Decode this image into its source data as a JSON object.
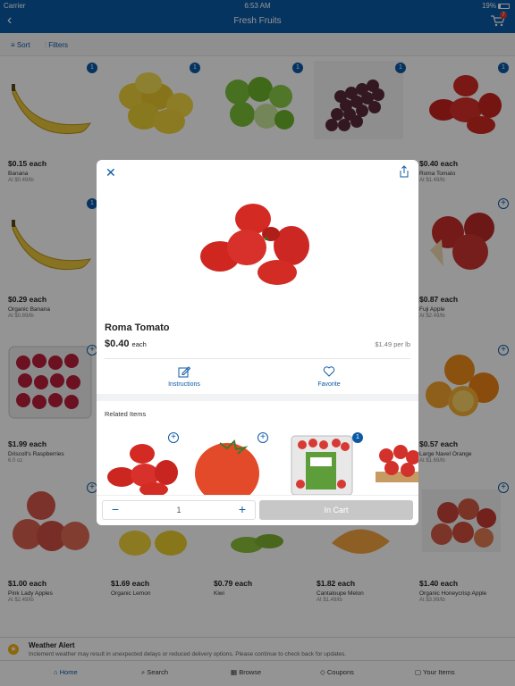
{
  "status": {
    "carrier": "Carrier",
    "time": "6:53 AM",
    "battery": "19%"
  },
  "nav": {
    "title": "Fresh Fruits",
    "cart_count": "7"
  },
  "toolbar": {
    "sort": "Sort",
    "filters": "Filters"
  },
  "grid": [
    {
      "price": "$0.15 each",
      "name": "Banana",
      "sub": "At $0.49/lb",
      "badge": "1"
    },
    {
      "price": "",
      "name": "",
      "sub": "",
      "badge": "1"
    },
    {
      "price": "",
      "name": "",
      "sub": "",
      "badge": "1"
    },
    {
      "price": "",
      "name": "",
      "sub": "",
      "badge": "1"
    },
    {
      "price": "$0.40 each",
      "name": "Roma Tomato",
      "sub": "At $1.49/lb",
      "badge": "1"
    },
    {
      "price": "$0.29 each",
      "name": "Organic Banana",
      "sub": "At $0.89/lb",
      "badge": "1"
    },
    {
      "price": "$0.87 each",
      "name": "Fuji Apple",
      "sub": "At $2.49/lb",
      "badge": "+"
    },
    {
      "price": "$1.99 each",
      "name": "Driscoll's Raspberries",
      "sub": "6.0 oz",
      "badge": "+"
    },
    {
      "price": "$0.57 each",
      "name": "Large Navel Orange",
      "sub": "At $1.69/lb",
      "badge": "+"
    },
    {
      "price": "$1.00 each",
      "name": "Pink Lady Apples",
      "sub": "At $2.49/lb",
      "badge": "+"
    },
    {
      "price": "$1.69 each",
      "name": "Organic Lemon",
      "sub": "",
      "badge": "+"
    },
    {
      "price": "$0.79 each",
      "name": "Kiwi",
      "sub": "",
      "badge": "+"
    },
    {
      "price": "$1.82 each",
      "name": "Cantaloupe Melon",
      "sub": "At $1.49/lb",
      "badge": "+"
    },
    {
      "price": "$1.40 each",
      "name": "Organic Honeycrisp Apple",
      "sub": "At $3.99/lb",
      "badge": "+"
    }
  ],
  "alert": {
    "title": "Weather Alert",
    "message": "Inclement weather may result in unexpected delays or reduced delivery options. Please continue to check back for updates."
  },
  "tabs": [
    "Home",
    "Search",
    "Browse",
    "Coupons",
    "Your Items"
  ],
  "modal": {
    "title": "Roma Tomato",
    "price": "$0.40",
    "price_suffix": "each",
    "unit_price": "$1.49 per lb",
    "actions": [
      "Instructions",
      "Favorite"
    ],
    "related_title": "Related Items",
    "related_badge": "1",
    "quantity": "1",
    "cart_button": "In Cart"
  },
  "colors": {
    "brand": "#0c5aa6",
    "badge_red": "#e23b2e"
  }
}
